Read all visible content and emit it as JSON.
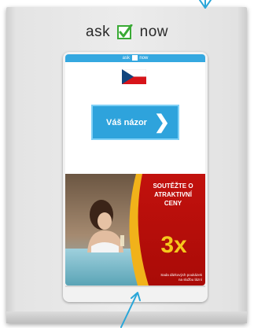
{
  "logo": {
    "word_left": "ask",
    "word_right": "now",
    "icon": "checkbox-check-icon"
  },
  "mini_bar": {
    "left": "ask",
    "right": "now"
  },
  "flag": {
    "icon": "czech-flag-icon"
  },
  "opinion_button": {
    "label": "Váš názor",
    "chevron": "❯"
  },
  "promo": {
    "title_lines": [
      "SOUTĚŽTE O",
      "ATRAKTIVNÍ",
      "CENY"
    ],
    "big": "3x",
    "small_lines": [
      "Sada dárkových poukázek",
      "na službu lázní"
    ]
  },
  "colors": {
    "accent_blue": "#2ea3dc",
    "logo_green": "#3aaa35",
    "promo_red": "#b70d09",
    "promo_gold": "#f5c81c"
  }
}
